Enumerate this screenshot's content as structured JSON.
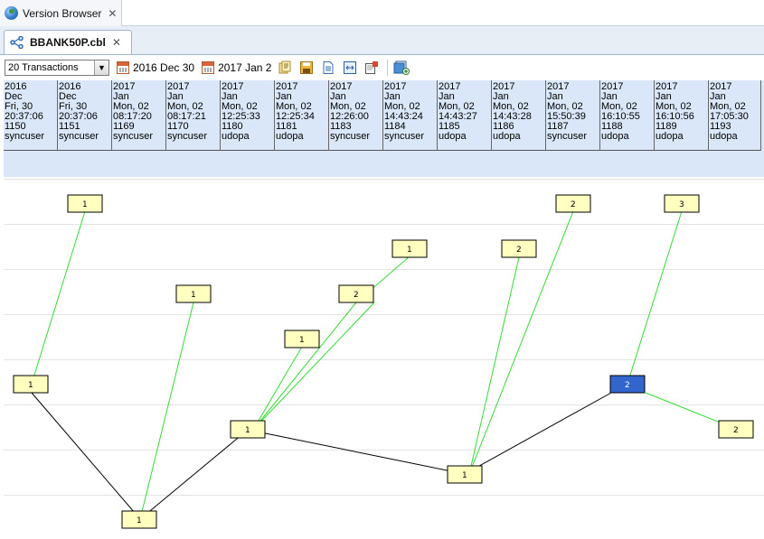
{
  "view": {
    "title": "Version Browser",
    "icon": "globe-icon"
  },
  "editor": {
    "tab_title": "BBANK50P.cbl",
    "icon": "branch-file-icon"
  },
  "toolbar": {
    "transactions_value": "20 Transactions",
    "start_date": "2016 Dec 30",
    "end_date": "2017 Jan 2",
    "icons": [
      "compare-icon",
      "save-icon",
      "document-icon",
      "fit-icon",
      "export-icon",
      "add-component-icon"
    ]
  },
  "transactions": [
    {
      "year": "2016",
      "month": "Dec",
      "day": "Fri, 30",
      "time": "20:37:06",
      "id": "1150",
      "user": "syncuser"
    },
    {
      "year": "2016",
      "month": "Dec",
      "day": "Fri, 30",
      "time": "20:37:06",
      "id": "1151",
      "user": "syncuser"
    },
    {
      "year": "2017",
      "month": "Jan",
      "day": "Mon, 02",
      "time": "08:17:20",
      "id": "1169",
      "user": "syncuser"
    },
    {
      "year": "2017",
      "month": "Jan",
      "day": "Mon, 02",
      "time": "08:17:21",
      "id": "1170",
      "user": "syncuser"
    },
    {
      "year": "2017",
      "month": "Jan",
      "day": "Mon, 02",
      "time": "12:25:33",
      "id": "1180",
      "user": "udopa"
    },
    {
      "year": "2017",
      "month": "Jan",
      "day": "Mon, 02",
      "time": "12:25:34",
      "id": "1181",
      "user": "udopa"
    },
    {
      "year": "2017",
      "month": "Jan",
      "day": "Mon, 02",
      "time": "12:26:00",
      "id": "1183",
      "user": "syncuser"
    },
    {
      "year": "2017",
      "month": "Jan",
      "day": "Mon, 02",
      "time": "14:43:24",
      "id": "1184",
      "user": "syncuser"
    },
    {
      "year": "2017",
      "month": "Jan",
      "day": "Mon, 02",
      "time": "14:43:27",
      "id": "1185",
      "user": "udopa"
    },
    {
      "year": "2017",
      "month": "Jan",
      "day": "Mon, 02",
      "time": "14:43:28",
      "id": "1186",
      "user": "udopa"
    },
    {
      "year": "2017",
      "month": "Jan",
      "day": "Mon, 02",
      "time": "15:50:39",
      "id": "1187",
      "user": "syncuser"
    },
    {
      "year": "2017",
      "month": "Jan",
      "day": "Mon, 02",
      "time": "16:10:55",
      "id": "1188",
      "user": "udopa"
    },
    {
      "year": "2017",
      "month": "Jan",
      "day": "Mon, 02",
      "time": "16:10:56",
      "id": "1189",
      "user": "udopa"
    },
    {
      "year": "2017",
      "month": "Jan",
      "day": "Mon, 02",
      "time": "17:05:30",
      "id": "1193",
      "user": "udopa"
    }
  ],
  "graph": {
    "colors": {
      "main_line": "#000000",
      "branch_line": "#33dd33",
      "node_fill": "#ffffc0",
      "selected_fill": "#3366cc"
    },
    "nodes": [
      {
        "id": "n1",
        "label": "1"
      },
      {
        "id": "n2",
        "label": "1"
      },
      {
        "id": "n3",
        "label": "1"
      },
      {
        "id": "n4",
        "label": "1"
      },
      {
        "id": "n5",
        "label": "1"
      },
      {
        "id": "n6",
        "label": "2"
      },
      {
        "id": "n7",
        "label": "1"
      },
      {
        "id": "n8",
        "label": "1"
      },
      {
        "id": "n9",
        "label": "1"
      },
      {
        "id": "n10",
        "label": "2"
      },
      {
        "id": "n11",
        "label": "2"
      },
      {
        "id": "n12",
        "label": "2",
        "selected": true
      },
      {
        "id": "n13",
        "label": "3"
      },
      {
        "id": "n14",
        "label": "2"
      }
    ],
    "edges": [
      {
        "from": "n1",
        "to": "n2",
        "kind": "main"
      },
      {
        "from": "n2",
        "to": "n3",
        "kind": "main"
      },
      {
        "from": "n3",
        "to": "n4",
        "kind": "main"
      },
      {
        "from": "n4",
        "to": "n12",
        "kind": "main"
      },
      {
        "from": "n1",
        "to": "n13b",
        "kind": "branch"
      }
    ]
  }
}
